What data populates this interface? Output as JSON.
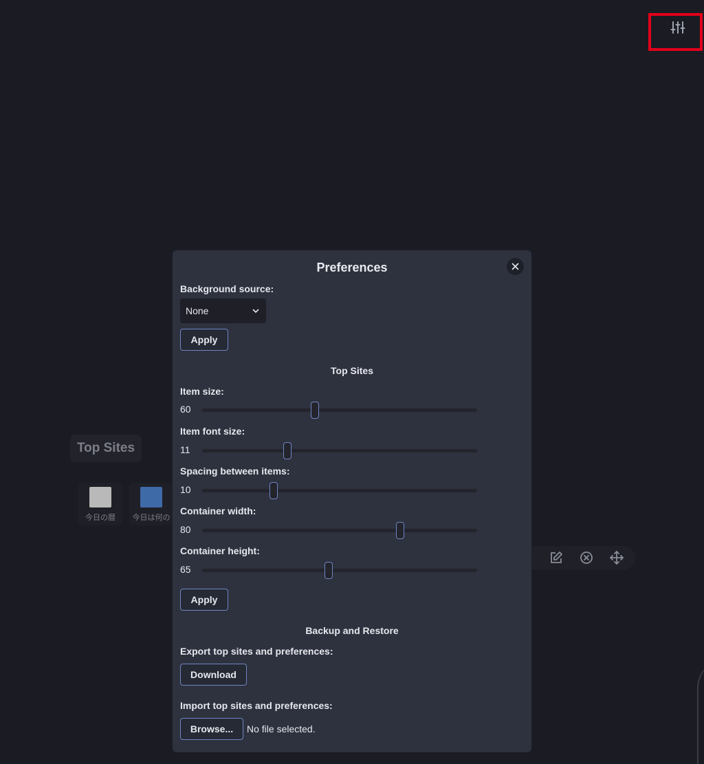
{
  "settings": {
    "icon": "sliders-icon",
    "highlight_color": "#e3001b"
  },
  "background": {
    "top_sites_title": "Top Sites",
    "tiles": [
      {
        "label": "今日の暦",
        "thumb_color": "#b9b9b9"
      },
      {
        "label": "今日は何の",
        "thumb_color": "#3f6aa8"
      }
    ],
    "toolbar_icons": [
      "edit-icon",
      "remove-circle-icon",
      "move-icon"
    ]
  },
  "preferences": {
    "title": "Preferences",
    "close_icon": "close-icon",
    "background_source": {
      "label": "Background source:",
      "value": "None"
    },
    "apply_label": "Apply",
    "top_sites_section": "Top Sites",
    "sliders": [
      {
        "label": "Item size:",
        "value": "60",
        "fraction": 0.41
      },
      {
        "label": "Item font size:",
        "value": "11",
        "fraction": 0.31
      },
      {
        "label": "Spacing between items:",
        "value": "10",
        "fraction": 0.26
      },
      {
        "label": "Container width:",
        "value": "80",
        "fraction": 0.72
      },
      {
        "label": "Container height:",
        "value": "65",
        "fraction": 0.46
      }
    ],
    "backup_section": "Backup and Restore",
    "export_label": "Export top sites and preferences:",
    "download_label": "Download",
    "import_label": "Import top sites and preferences:",
    "browse_label": "Browse...",
    "no_file_text": "No file selected."
  },
  "colors": {
    "page_bg": "#1b1c23",
    "modal_bg": "#2e323e",
    "accent_border": "#6f86c4"
  }
}
